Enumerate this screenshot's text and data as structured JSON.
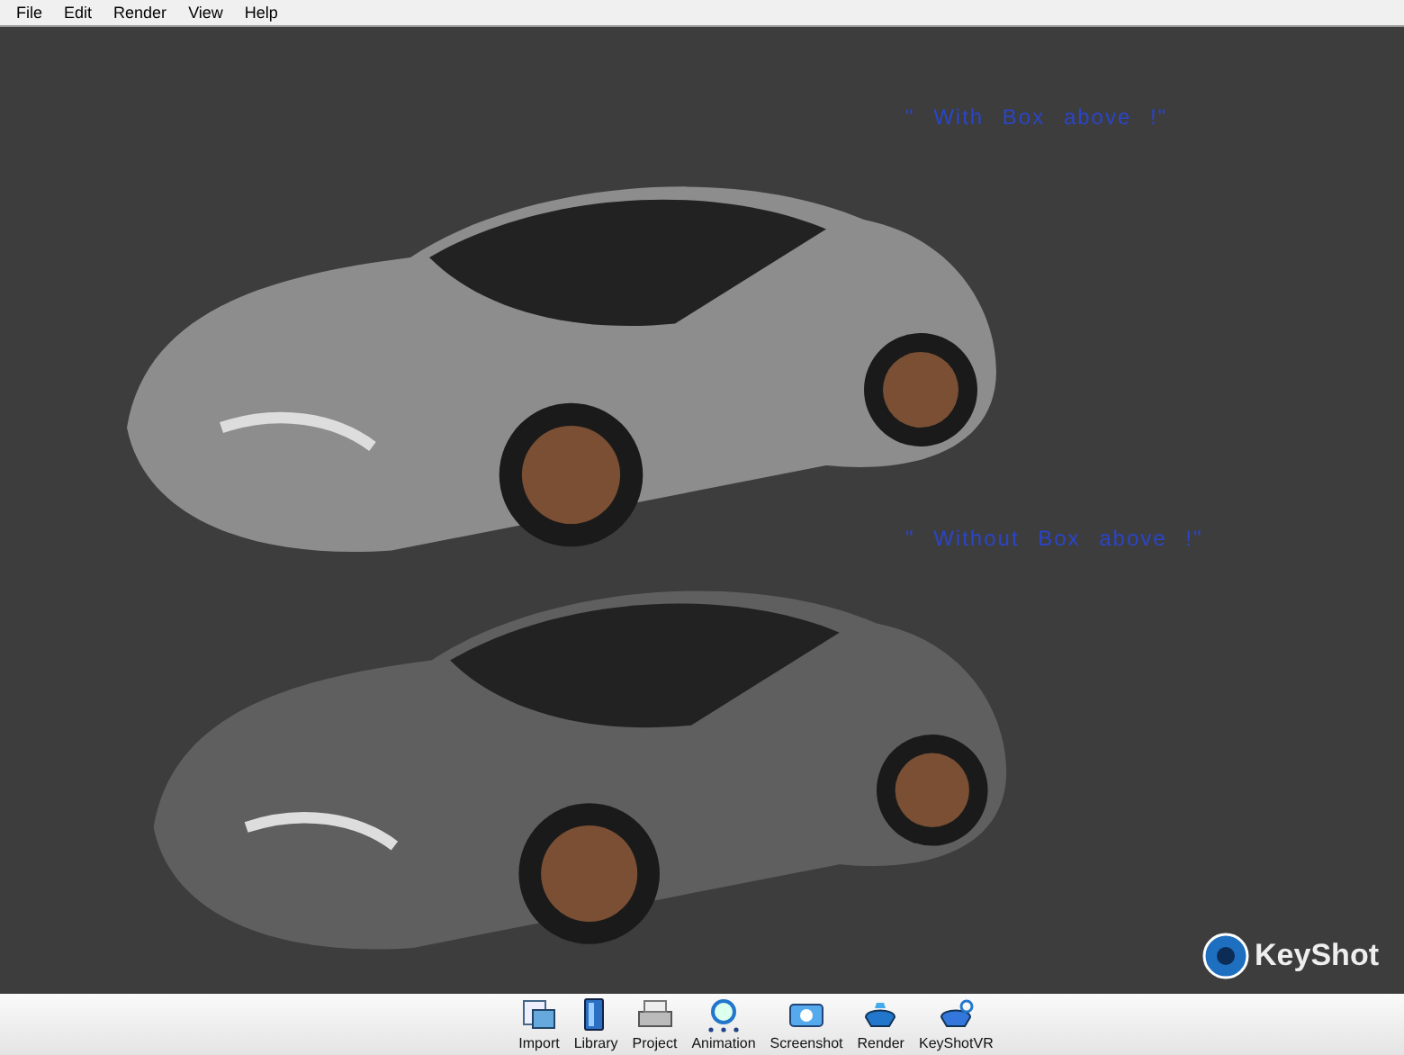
{
  "menu": [
    "File",
    "Edit",
    "Render",
    "View",
    "Help"
  ],
  "viewport": {
    "notes": [
      "\" With Box above !\"",
      "\" Without Box above !\""
    ],
    "logo": "KeyShot"
  },
  "toolbar": [
    {
      "label": "Import",
      "kind": "import"
    },
    {
      "label": "Library",
      "kind": "library"
    },
    {
      "label": "Project",
      "kind": "project"
    },
    {
      "label": "Animation",
      "kind": "animation"
    },
    {
      "label": "Screenshot",
      "kind": "screenshot"
    },
    {
      "label": "Render",
      "kind": "render"
    },
    {
      "label": "KeyShotVR",
      "kind": "vr"
    }
  ]
}
